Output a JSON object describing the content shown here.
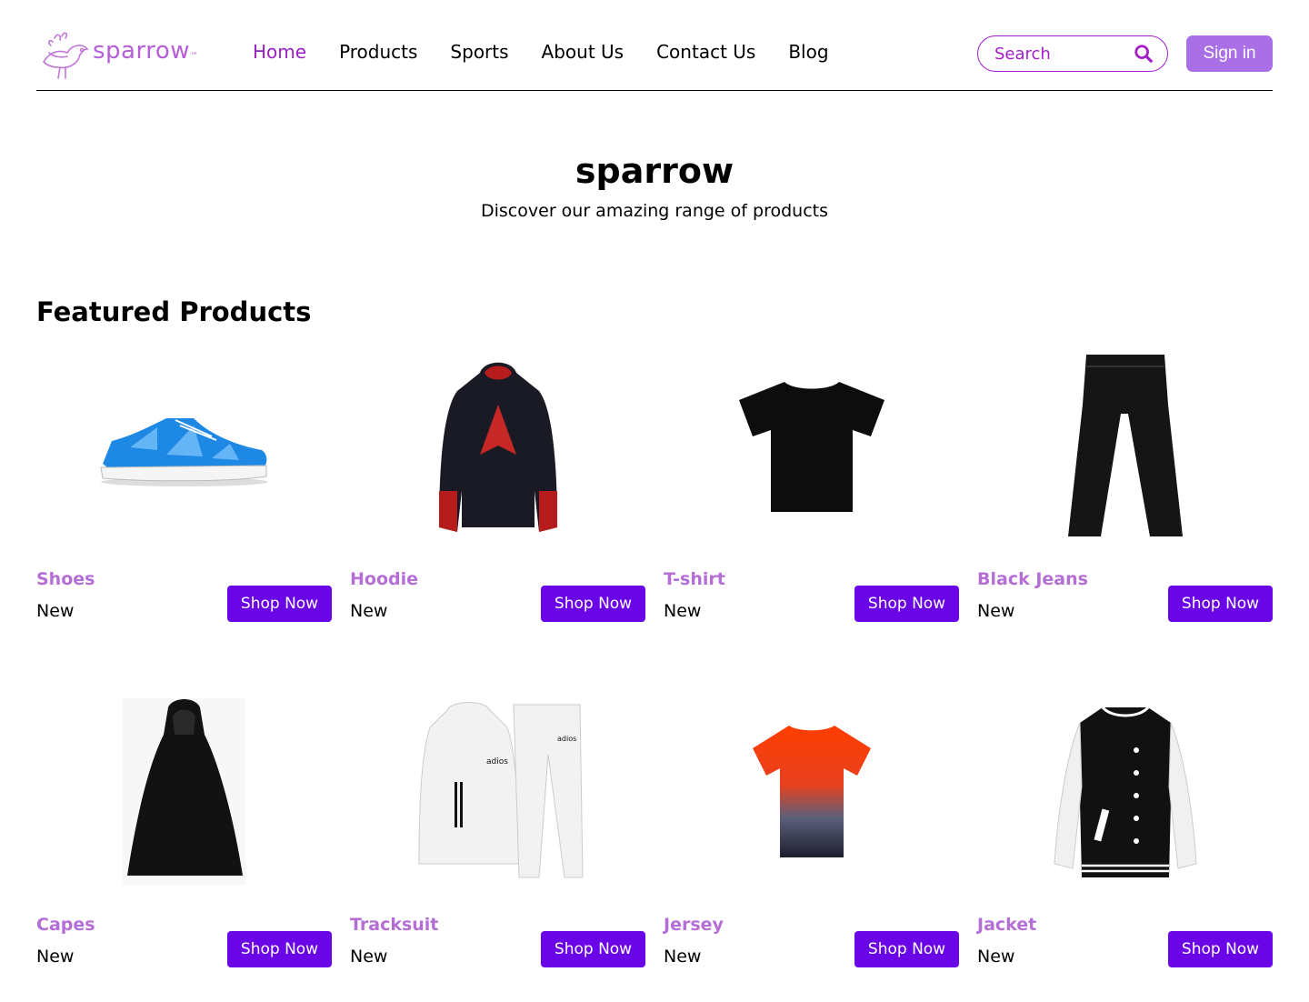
{
  "brand": {
    "name": "sparrow",
    "tm": "™",
    "color": "#b65ed8"
  },
  "nav": {
    "items": [
      {
        "label": "Home",
        "active": true
      },
      {
        "label": "Products",
        "active": false
      },
      {
        "label": "Sports",
        "active": false
      },
      {
        "label": "About Us",
        "active": false
      },
      {
        "label": "Contact Us",
        "active": false
      },
      {
        "label": "Blog",
        "active": false
      }
    ],
    "active_color": "#9b1fc4"
  },
  "search": {
    "placeholder": "Search",
    "icon": "search-icon"
  },
  "signin": {
    "label": "Sign in",
    "color": "#a96fe6"
  },
  "hero": {
    "title": "sparrow",
    "subtitle": "Discover our amazing range of products"
  },
  "featured": {
    "title": "Featured Products",
    "button_color": "#6a05e8",
    "products": [
      {
        "name": "Shoes",
        "tag": "New",
        "button": "Shop Now",
        "image": "sneaker"
      },
      {
        "name": "Hoodie",
        "tag": "New",
        "button": "Shop Now",
        "image": "hoodie"
      },
      {
        "name": "T-shirt",
        "tag": "New",
        "button": "Shop Now",
        "image": "tshirt"
      },
      {
        "name": "Black Jeans",
        "tag": "New",
        "button": "Shop Now",
        "image": "jeans"
      },
      {
        "name": "Capes",
        "tag": "New",
        "button": "Shop Now",
        "image": "cape"
      },
      {
        "name": "Tracksuit",
        "tag": "New",
        "button": "Shop Now",
        "image": "tracksuit"
      },
      {
        "name": "Jersey",
        "tag": "New",
        "button": "Shop Now",
        "image": "jersey"
      },
      {
        "name": "Jacket",
        "tag": "New",
        "button": "Shop Now",
        "image": "jacket"
      }
    ]
  }
}
